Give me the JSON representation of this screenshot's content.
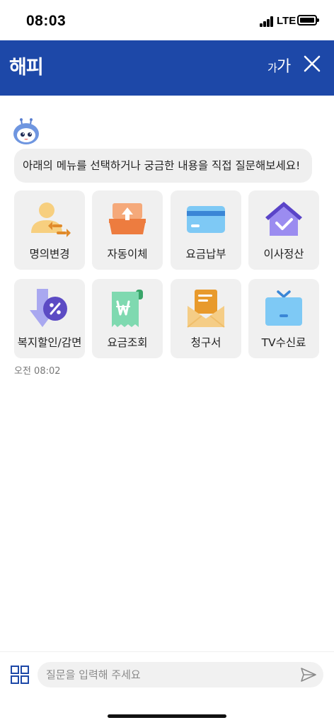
{
  "status_bar": {
    "time": "08:03",
    "network": "LTE"
  },
  "header": {
    "logo": "해피",
    "font_size_small": "가",
    "font_size_large": "가",
    "brand_color": "#1d48a8"
  },
  "chat": {
    "bot_icon": "robot-mascot-icon",
    "greeting": "아래의 메뉴를 선택하거나 궁금한 내용을 직접 질문해보세요!",
    "menu": [
      {
        "label": "명의변경",
        "icon": "person-transfer-icon"
      },
      {
        "label": "자동이체",
        "icon": "auto-transfer-icon"
      },
      {
        "label": "요금납부",
        "icon": "credit-card-icon"
      },
      {
        "label": "이사정산",
        "icon": "house-check-icon"
      },
      {
        "label": "복지할인/감면",
        "icon": "discount-percent-icon"
      },
      {
        "label": "요금조회",
        "icon": "won-receipt-icon"
      },
      {
        "label": "청구서",
        "icon": "envelope-bill-icon"
      },
      {
        "label": "TV수신료",
        "icon": "tv-icon"
      }
    ],
    "timestamp": "오전 08:02"
  },
  "input_bar": {
    "placeholder": "질문을 입력해 주세요",
    "value": ""
  }
}
